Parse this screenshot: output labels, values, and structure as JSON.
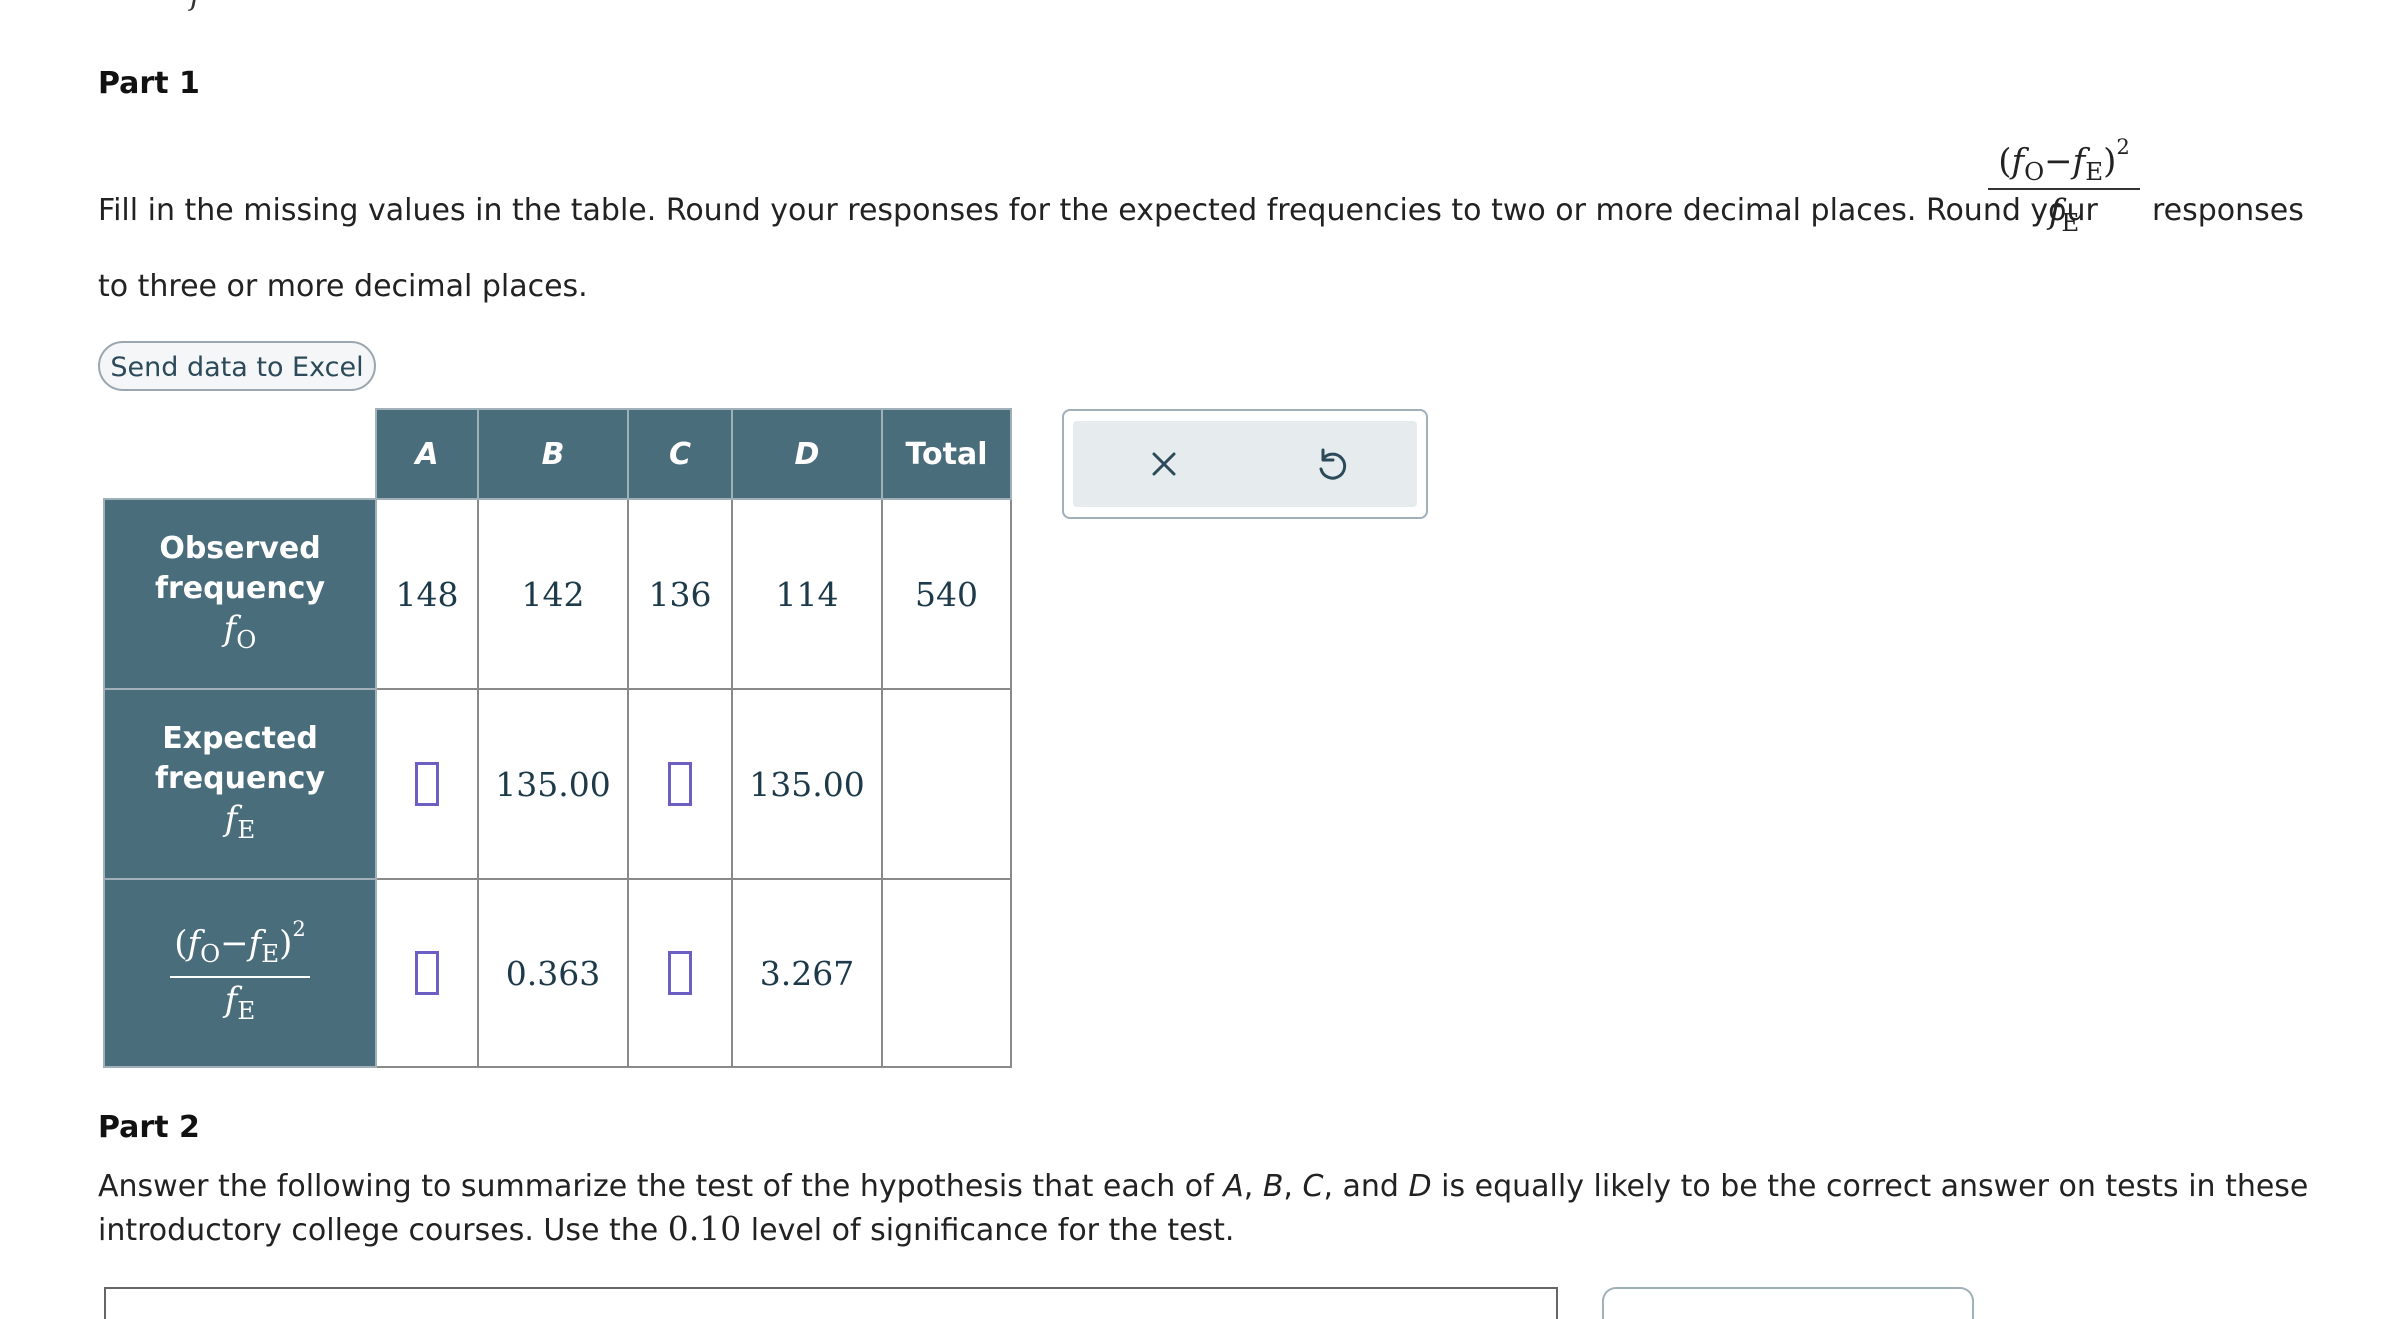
{
  "top_residue": "f",
  "part1": {
    "title": "Part 1",
    "instruction_a": "Fill in the missing values in the table. Round your responses for the expected frequencies to two or more decimal places. Round your",
    "instruction_b": "responses",
    "instruction_c": "to three or more decimal places.",
    "formula": {
      "f": "f",
      "o": "O",
      "e": "E",
      "minus": "−",
      "exp": "2",
      "lparen": "(",
      "rparen": ")"
    }
  },
  "excel_button": "Send data to Excel",
  "table": {
    "columns": [
      "A",
      "B",
      "C",
      "D",
      "Total"
    ],
    "rows": [
      {
        "label1": "Observed",
        "label2": "frequency",
        "sym": "f",
        "sym_sub": "O",
        "cells": [
          "148",
          "142",
          "136",
          "114",
          "540"
        ]
      },
      {
        "label1": "Expected",
        "label2": "frequency",
        "sym": "f",
        "sym_sub": "E",
        "cells": [
          "",
          "135.00",
          "",
          "135.00",
          ""
        ]
      },
      {
        "label1": "",
        "label2": "",
        "sym": "",
        "sym_sub": "",
        "cells": [
          "",
          "0.363",
          "",
          "3.267",
          ""
        ]
      }
    ]
  },
  "actions": {
    "clear_icon": "close-icon",
    "undo_icon": "undo-icon"
  },
  "part2": {
    "title": "Part 2",
    "text_1": "Answer the following to summarize the test of the hypothesis that each of ",
    "a": "A",
    "c1": ", ",
    "b": "B",
    "c2": ", ",
    "c": "C",
    "c3": ", and ",
    "d": "D",
    "text_2": " is equally likely to be the correct answer on tests in these",
    "line2_a": "introductory college courses. Use the ",
    "level": "0.10",
    "line2_b": " level of significance for the test."
  }
}
